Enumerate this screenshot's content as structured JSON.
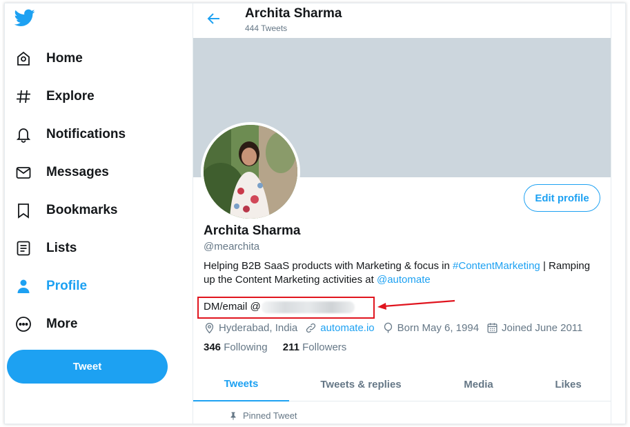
{
  "sidebar": {
    "logo": "twitter-bird-icon",
    "items": [
      {
        "label": "Home",
        "icon": "home-icon"
      },
      {
        "label": "Explore",
        "icon": "hashtag-icon"
      },
      {
        "label": "Notifications",
        "icon": "bell-icon"
      },
      {
        "label": "Messages",
        "icon": "envelope-icon"
      },
      {
        "label": "Bookmarks",
        "icon": "bookmark-icon"
      },
      {
        "label": "Lists",
        "icon": "list-icon"
      },
      {
        "label": "Profile",
        "icon": "person-icon",
        "active": true
      },
      {
        "label": "More",
        "icon": "more-circle-icon"
      }
    ],
    "tweet_button": "Tweet"
  },
  "header": {
    "title": "Archita Sharma",
    "subtitle": "444 Tweets"
  },
  "profile": {
    "edit_button": "Edit profile",
    "name": "Archita Sharma",
    "handle": "@mearchita",
    "bio_part1": "Helping B2B SaaS products with Marketing & focus in ",
    "bio_hashtag": "#ContentMarketing",
    "bio_part2": " | Ramping up the Content Marketing activities at ",
    "bio_mention": "@automate",
    "dm_email": "DM/email @",
    "location": "Hyderabad, India",
    "website": "automate.io",
    "birthday": "Born May 6, 1994",
    "joined": "Joined June 2011",
    "following_count": "346",
    "following_label": "Following",
    "followers_count": "211",
    "followers_label": "Followers"
  },
  "tabs": [
    {
      "label": "Tweets",
      "active": true
    },
    {
      "label": "Tweets & replies"
    },
    {
      "label": "Media"
    },
    {
      "label": "Likes"
    }
  ],
  "pinned_label": "Pinned Tweet",
  "colors": {
    "accent": "#1da1f2",
    "banner": "#ccd6dd",
    "annotation": "#e0141e",
    "muted": "#657786"
  }
}
